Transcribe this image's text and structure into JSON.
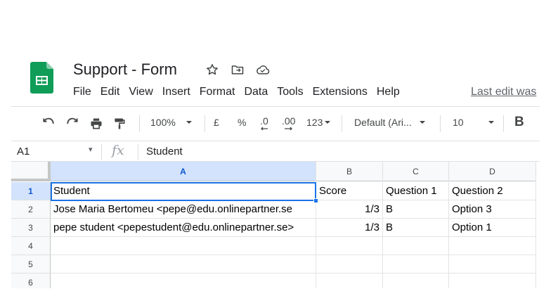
{
  "document": {
    "title": "Support  - Form",
    "last_edit": "Last edit was"
  },
  "menu": [
    "File",
    "Edit",
    "View",
    "Insert",
    "Format",
    "Data",
    "Tools",
    "Extensions",
    "Help"
  ],
  "toolbar": {
    "zoom": "100%",
    "currency": "£",
    "percent": "%",
    "decrease_decimal": ".0",
    "increase_decimal": ".00",
    "number_format": "123",
    "font": "Default (Ari...",
    "font_size": "10",
    "bold": "B"
  },
  "formula_bar": {
    "cell_ref": "A1",
    "fx": "fx",
    "value": "Student"
  },
  "grid": {
    "columns": [
      "A",
      "B",
      "C",
      "D"
    ],
    "rows": [
      "1",
      "2",
      "3",
      "4",
      "5",
      "6"
    ],
    "cells": [
      [
        "Student",
        "Score",
        "Question 1",
        "Question 2"
      ],
      [
        "Jose Maria Bertomeu <pepe@edu.onlinepartner.se",
        "1/3",
        "B",
        "Option 3"
      ],
      [
        "pepe student <pepestudent@edu.onlinepartner.se>",
        "1/3",
        "B",
        "Option 1"
      ],
      [
        "",
        "",
        "",
        ""
      ],
      [
        "",
        "",
        "",
        ""
      ],
      [
        "",
        "",
        "",
        ""
      ]
    ]
  },
  "colors": {
    "selection": "#1a73e8",
    "sheets_green": "#0f9d58"
  }
}
